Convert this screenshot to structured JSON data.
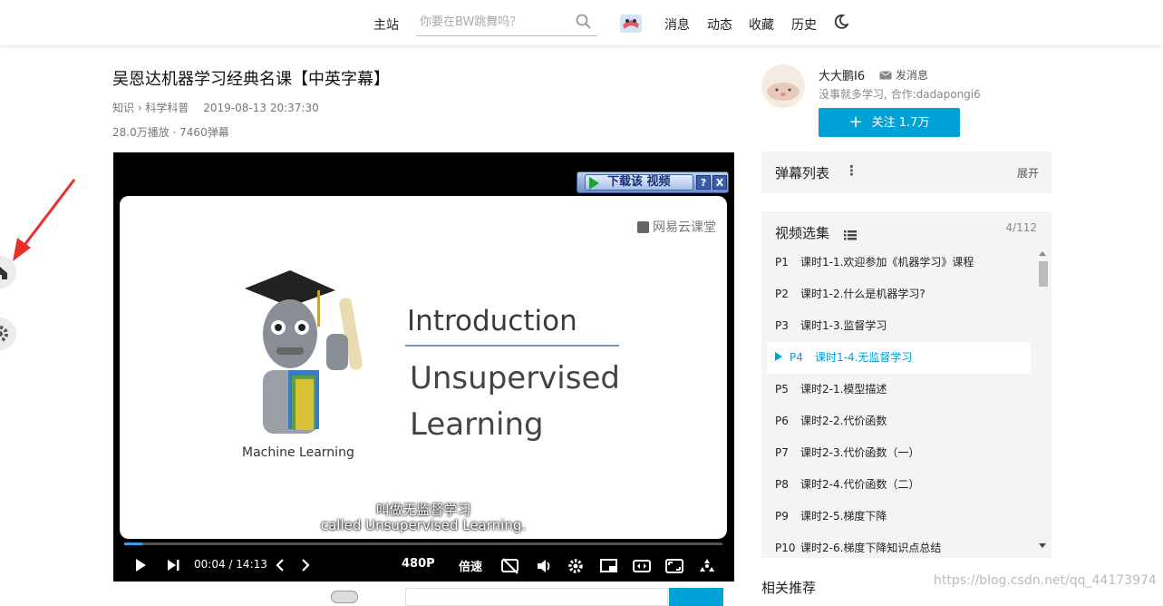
{
  "topbar": {
    "home": "主站",
    "search_placeholder": "你要在BW跳舞吗？",
    "nav": [
      "消息",
      "动态",
      "收藏",
      "历史"
    ]
  },
  "video": {
    "title": "吴恩达机器学习经典名课【中英字幕】",
    "category": "知识 › 科学科普",
    "date": "2019-08-13 20:37:30",
    "stats": "28.0万播放 · 7460弹幕"
  },
  "player": {
    "download_label": "下载该 视频",
    "download_help": "?",
    "download_close": "X",
    "brand": "网易云课堂",
    "slide_caption": "Machine Learning",
    "slide_title": "Introduction",
    "slide_subtitle_1": "Unsupervised",
    "slide_subtitle_2": "Learning",
    "subtitle_cn": "叫做无监督学习",
    "subtitle_en": "called Unsupervised Learning.",
    "progress": 0.0047,
    "time_current": "00:04",
    "time_sep": "/",
    "time_total": "14:13",
    "quality": "480P",
    "speed": "倍速"
  },
  "uploader": {
    "name": "大大鹏I6",
    "send_message": "发消息",
    "description": "没事就多学习, 合作:dadapongi6",
    "follow_label": "关注 1.7万"
  },
  "danmu": {
    "label": "弹幕列表",
    "expand": "展开"
  },
  "playlist": {
    "label": "视频选集",
    "count": "4/112",
    "items": [
      {
        "num": "P1",
        "title": "课时1-1.欢迎参加《机器学习》课程"
      },
      {
        "num": "P2",
        "title": "课时1-2.什么是机器学习?"
      },
      {
        "num": "P3",
        "title": "课时1-3.监督学习"
      },
      {
        "num": "P4",
        "title": "课时1-4.无监督学习"
      },
      {
        "num": "P5",
        "title": "课时2-1.模型描述"
      },
      {
        "num": "P6",
        "title": "课时2-2.代价函数"
      },
      {
        "num": "P7",
        "title": "课时2-3.代价函数（一）"
      },
      {
        "num": "P8",
        "title": "课时2-4.代价函数（二）"
      },
      {
        "num": "P9",
        "title": "课时2-5.梯度下降"
      },
      {
        "num": "P10",
        "title": "课时2-6.梯度下降知识点总结"
      }
    ],
    "active_index": 3
  },
  "related": {
    "label": "相关推荐"
  },
  "watermark": "https://blog.csdn.net/qq_44173974",
  "colors": {
    "accent": "#00a1d6",
    "arrow": "#e8302a"
  }
}
